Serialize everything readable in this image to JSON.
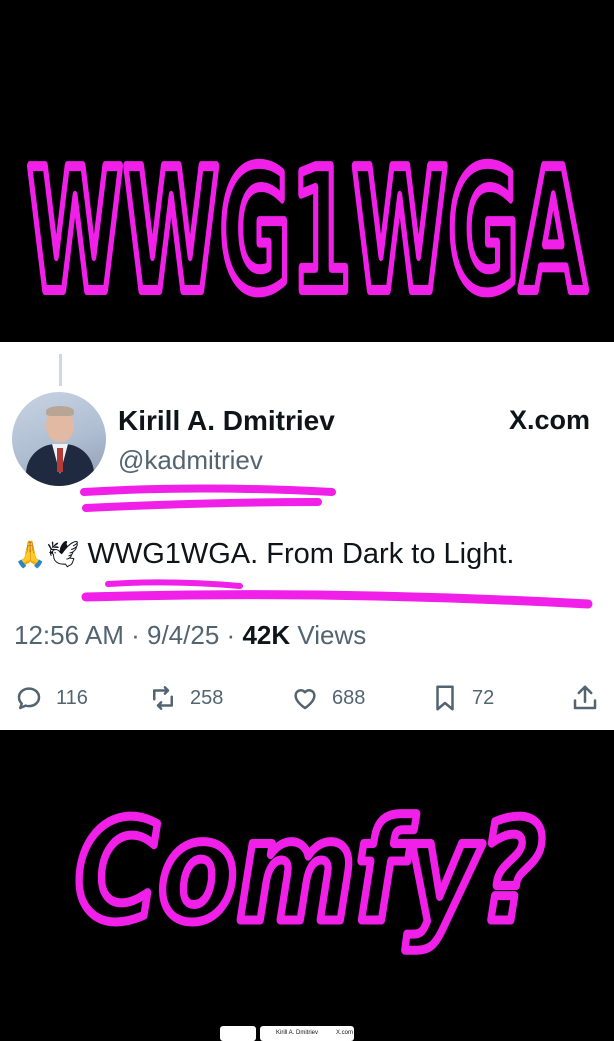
{
  "overlay": {
    "top_scribble": "WWG1WGA",
    "bottom_scribble": "Comfy?",
    "ink_color": "#f020e8"
  },
  "tweet": {
    "display_name": "Kirill A. Dmitriev",
    "handle": "@kadmitriev",
    "source_logo": "X.com",
    "emoji_prefix": "🙏🕊",
    "text": "WWG1WGA. From Dark to Light.",
    "time": "12:56 AM",
    "date": "9/4/25",
    "views_count": "42K",
    "views_label": "Views",
    "separator": "·",
    "actions": {
      "replies": "116",
      "reposts": "258",
      "likes": "688",
      "bookmarks": "72"
    }
  },
  "thumbnail": {
    "name": "Kirill A. Dmitriev",
    "source": "X.com"
  }
}
